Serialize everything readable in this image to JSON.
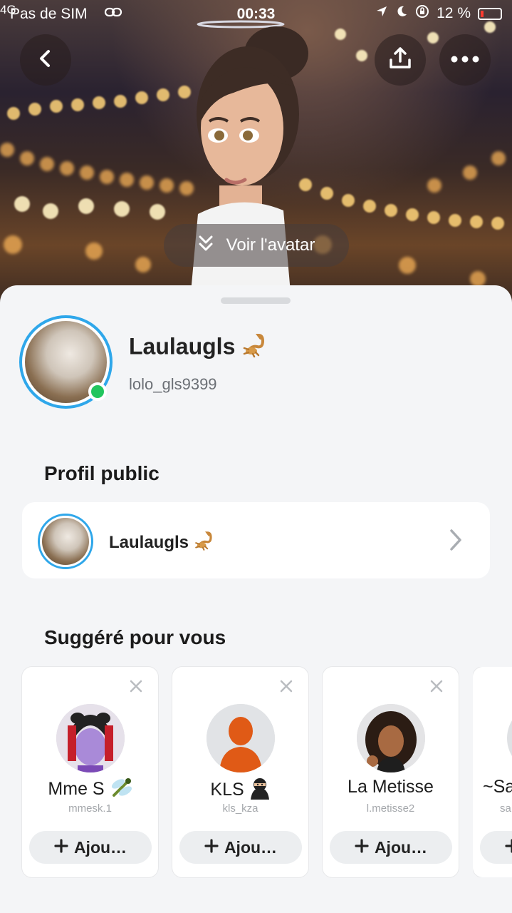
{
  "status_bar": {
    "network": "4G",
    "carrier": "Pas de SIM",
    "time": "00:33",
    "battery": "12 %"
  },
  "header": {
    "view_avatar_label": "Voir l'avatar"
  },
  "profile": {
    "display_name": "Laulaugls",
    "username": "lolo_gls9399",
    "online": true
  },
  "public_profile": {
    "section_title": "Profil public",
    "name": "Laulaugls"
  },
  "suggestions": {
    "section_title": "Suggéré pour vous",
    "add_label": "Ajou…",
    "items": [
      {
        "name": "Mme S",
        "username": "mmesk.1"
      },
      {
        "name": "KLS",
        "username": "kls_kza"
      },
      {
        "name": "La Metisse",
        "username": "l.metisse2"
      },
      {
        "name": "~Sa",
        "username": "sa"
      }
    ]
  },
  "colors": {
    "accent_ring": "#2fa7ea",
    "online": "#22c55e",
    "battery_low": "#ff3b30"
  }
}
